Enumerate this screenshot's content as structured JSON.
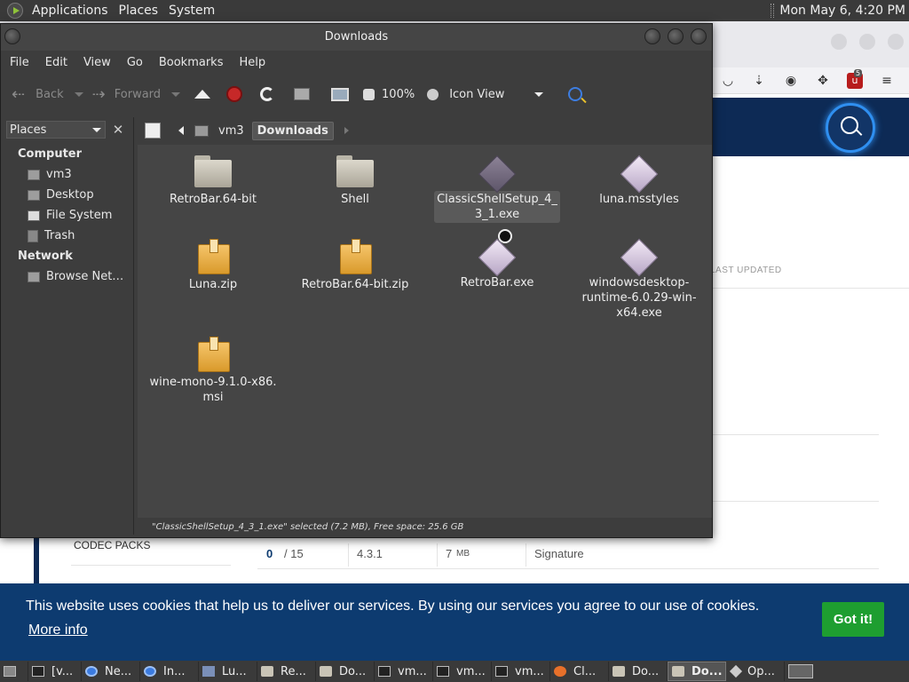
{
  "top_panel": {
    "menus": [
      "Applications",
      "Places",
      "System"
    ],
    "clock": "Mon May  6,  4:20 PM"
  },
  "file_manager": {
    "title": "Downloads",
    "menubar": [
      "File",
      "Edit",
      "View",
      "Go",
      "Bookmarks",
      "Help"
    ],
    "toolbar": {
      "back": "Back",
      "forward": "Forward",
      "zoom": "100%",
      "view_mode": "Icon View"
    },
    "sidebar": {
      "selector": "Places",
      "sections": [
        {
          "heading": "Computer",
          "items": [
            "vm3",
            "Desktop",
            "File System",
            "Trash"
          ]
        },
        {
          "heading": "Network",
          "items": [
            "Browse Net…"
          ]
        }
      ]
    },
    "path": {
      "parent": "vm3",
      "current": "Downloads"
    },
    "files": [
      {
        "name": "RetroBar.64-bit",
        "kind": "folder"
      },
      {
        "name": "Shell",
        "kind": "folder"
      },
      {
        "name": "ClassicShellSetup_4_3_1.exe",
        "display": "ClassicShellSetup_4_\n3_1.exe",
        "kind": "exe-selected",
        "selected": true
      },
      {
        "name": "luna.msstyles",
        "kind": "exe"
      },
      {
        "name": "Luna.zip",
        "kind": "zip"
      },
      {
        "name": "RetroBar.64-bit.zip",
        "kind": "zip"
      },
      {
        "name": "RetroBar.exe",
        "kind": "exe"
      },
      {
        "name": "windowsdesktop-runtime-6.0.29-win-x64.exe",
        "display": "windowsdesktop-\nruntime-6.0.29-win-\nx64.exe",
        "kind": "exe"
      },
      {
        "name": "wine-mono-9.1.0-x86.msi",
        "display": "wine-mono-9.1.0-x86.\nmsi",
        "kind": "zip"
      }
    ],
    "status": "\"ClassicShellSetup_4_3_1.exe\" selected (7.2 MB), Free space: 25.6 GB"
  },
  "browser_page": {
    "last_updated": "LAST UPDATED",
    "codec_packs": "CODEC PACKS",
    "row": {
      "count": "0",
      "total": "/ 15",
      "version": "4.3.1",
      "size": "7",
      "size_unit": "MB",
      "signature": "Signature"
    },
    "notification_badge": "5"
  },
  "cookie_bar": {
    "text": "This website uses cookies that help us to deliver our services. By using our services you agree to our use of cookies.",
    "more": "More info",
    "button": "Got it!",
    "bg_color": "#0d3b70",
    "button_color": "#1e9e30"
  },
  "taskbar": {
    "items": [
      {
        "icon": "terminal-icon",
        "label": "[v..."
      },
      {
        "icon": "chrome-icon",
        "label": "Ne..."
      },
      {
        "icon": "chrome-icon",
        "label": "In..."
      },
      {
        "icon": "app-icon",
        "label": "Lu..."
      },
      {
        "icon": "folder-icon",
        "label": "Re..."
      },
      {
        "icon": "folder-icon",
        "label": "Do..."
      },
      {
        "icon": "terminal-icon",
        "label": "vm..."
      },
      {
        "icon": "terminal-icon",
        "label": "vm..."
      },
      {
        "icon": "terminal-icon",
        "label": "vm..."
      },
      {
        "icon": "firefox-icon",
        "label": "Cl..."
      },
      {
        "icon": "folder-icon",
        "label": "Do..."
      },
      {
        "icon": "folder-icon",
        "label": "Do...",
        "active": true
      },
      {
        "icon": "diamond-icon",
        "label": "Op..."
      }
    ]
  }
}
